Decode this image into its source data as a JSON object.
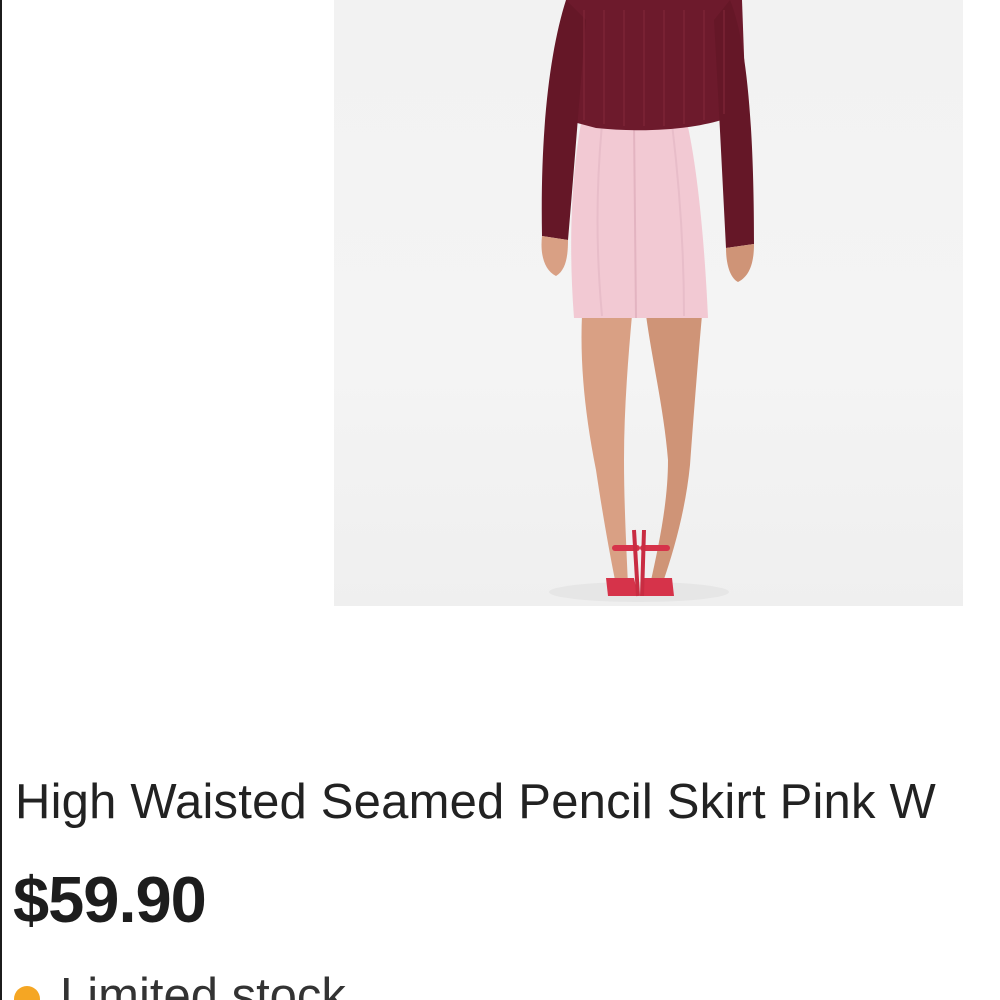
{
  "product": {
    "image_icon": "product-photo",
    "title": "High Waisted Seamed Pencil Skirt Pink W",
    "price": "$59.90",
    "stock": {
      "label": "Limited stock",
      "indicator_color": "#f5a623"
    }
  },
  "colors": {
    "background": "#ffffff",
    "text": "#222222",
    "image_background": "#f2f2f2",
    "sweater": "#6d1a2c",
    "skirt": "#f2c9d3",
    "sandals": "#d6334a"
  }
}
